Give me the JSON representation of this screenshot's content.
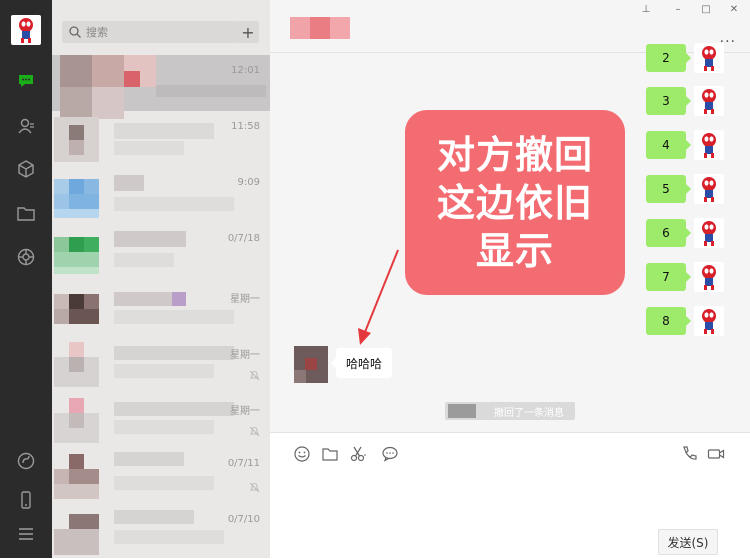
{
  "search": {
    "placeholder": "搜索",
    "add_label": "+"
  },
  "chat_list": {
    "items": [
      {
        "time": "12:01",
        "active": true,
        "muted": false
      },
      {
        "time": "11:58",
        "active": false,
        "muted": false
      },
      {
        "time": "9:09",
        "active": false,
        "muted": false
      },
      {
        "time": "0/7/18",
        "active": false,
        "muted": false
      },
      {
        "time": "星期一",
        "active": false,
        "muted": false
      },
      {
        "time": "星期一",
        "active": false,
        "muted": true
      },
      {
        "time": "星期一",
        "active": false,
        "muted": true
      },
      {
        "time": "0/7/11",
        "active": false,
        "muted": true
      },
      {
        "time": "0/7/10",
        "active": false,
        "muted": false
      }
    ]
  },
  "window_controls": {
    "pin": "⊥",
    "minimize": "–",
    "maximize": "□",
    "close": "✕"
  },
  "header": {
    "more": "..."
  },
  "messages": {
    "outgoing_numbers": [
      "2",
      "3",
      "4",
      "5",
      "6",
      "7",
      "8"
    ],
    "incoming_text": "哈哈哈",
    "recall_notice": "撤回了一条消息"
  },
  "annotation": {
    "line1": "对方撤回",
    "line2": "这边依旧",
    "line3": "显示"
  },
  "input_area": {
    "send_label": "发送(S)"
  },
  "colors": {
    "rail": "#2b2b2b",
    "list_bg": "#eae8e7",
    "chat_bg": "#f5f5f5",
    "bubble_green": "#9eea6a",
    "annotation": "#f36c72",
    "accent_green": "#1aad19"
  },
  "icons": {
    "rail": [
      "chat-icon",
      "contacts-icon",
      "favorites-icon",
      "files-icon",
      "moments-icon",
      "miniprogram-icon",
      "phone-icon",
      "menu-icon"
    ],
    "toolbar": [
      "emoji-icon",
      "folder-icon",
      "scissors-icon",
      "chat-bubble-icon",
      "call-icon",
      "video-icon"
    ]
  }
}
